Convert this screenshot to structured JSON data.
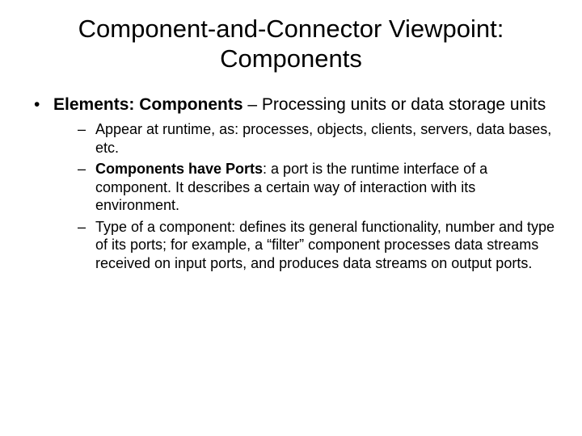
{
  "title": "Component-and-Connector Viewpoint: Components",
  "bullet1": {
    "label": "Elements: Components",
    "sep": " – ",
    "rest": "Processing units or data storage units"
  },
  "sub": [
    {
      "text": "Appear at runtime, as: processes, objects, clients, servers, data bases, etc."
    },
    {
      "bold": "Components have Ports",
      "text": ":  a port is the runtime interface of a component. It describes a certain way of interaction with its environment."
    },
    {
      "text": "Type of a component: defines its general functionality, number and type of its ports; for example, a  “filter” component processes data streams received on input ports, and produces data streams on output ports."
    }
  ]
}
